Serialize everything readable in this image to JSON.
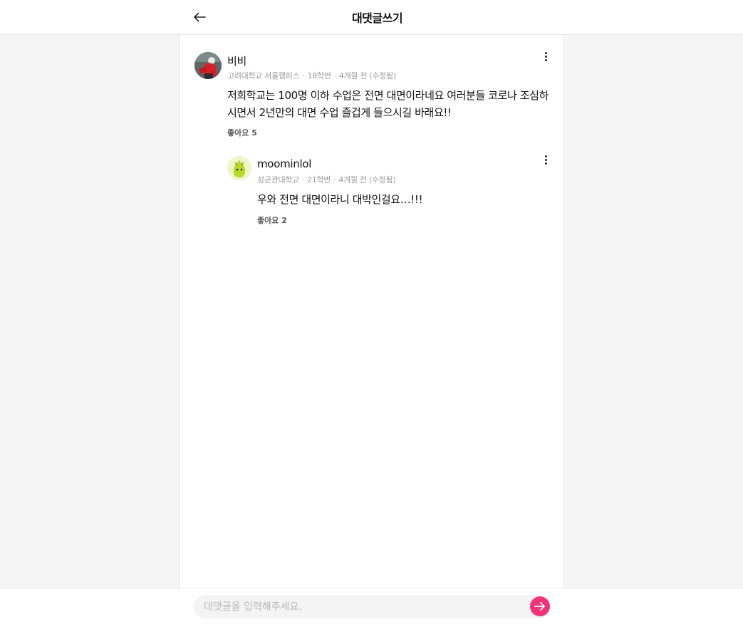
{
  "header": {
    "title": "대댓글쓰기",
    "back_icon": "arrow-left-icon"
  },
  "comment": {
    "author": "비비",
    "school": "고려대학교 서울캠퍼스",
    "year": "18학번",
    "time": "4개월 전 (수정됨)",
    "body": "저희학교는 100명 이하 수업은 전면 대면이라네요 여러분들 코로나 조심하시면서 2년만의 대면 수업 즐겁게 들으시길 바래요!!",
    "likes": "좋아요 5",
    "more_icon": "more-vertical-icon"
  },
  "reply": {
    "author": "moominlol",
    "school": "성균관대학교",
    "year": "21학번",
    "time": "4개월 전 (수정됨)",
    "body": "우와 전면 대면이라니 대박인걸요…!!!",
    "likes": "좋아요 2",
    "more_icon": "more-vertical-icon"
  },
  "composer": {
    "placeholder": "대댓글을 입력해주세요.",
    "value": "",
    "send_icon": "arrow-right-icon"
  },
  "colors": {
    "accent": "#f2337a",
    "background": "#f5f5f5",
    "meta_text": "#9a9a9a"
  }
}
